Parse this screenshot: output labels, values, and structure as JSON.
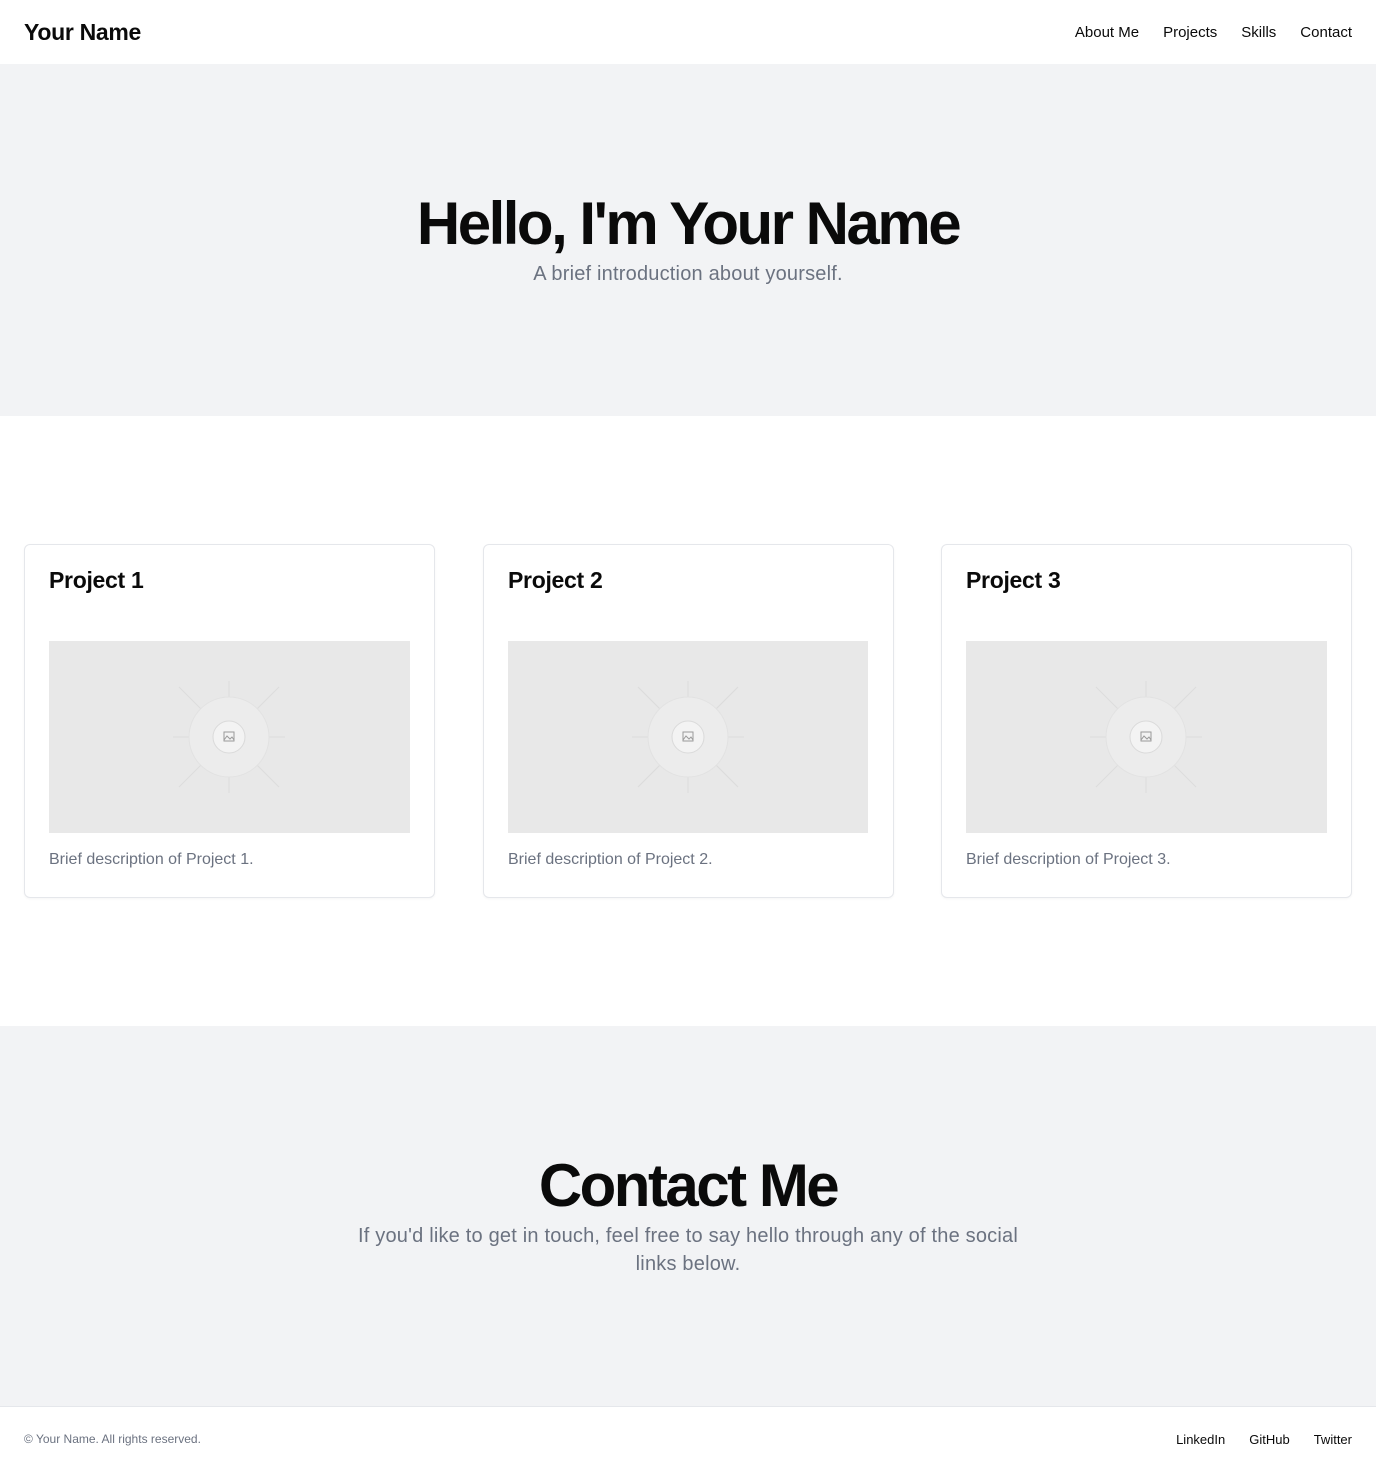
{
  "header": {
    "brand": "Your Name",
    "nav": [
      "About Me",
      "Projects",
      "Skills",
      "Contact"
    ]
  },
  "hero": {
    "title": "Hello, I'm Your Name",
    "subtitle": "A brief introduction about yourself."
  },
  "projects": [
    {
      "title": "Project 1",
      "description": "Brief description of Project 1.",
      "image_icon": "image-placeholder-icon"
    },
    {
      "title": "Project 2",
      "description": "Brief description of Project 2.",
      "image_icon": "image-placeholder-icon"
    },
    {
      "title": "Project 3",
      "description": "Brief description of Project 3.",
      "image_icon": "image-placeholder-icon"
    }
  ],
  "contact": {
    "title": "Contact Me",
    "text": "If you'd like to get in touch, feel free to say hello through any of the social links below."
  },
  "footer": {
    "copyright": "© Your Name. All rights reserved.",
    "social": [
      "LinkedIn",
      "GitHub",
      "Twitter"
    ]
  },
  "colors": {
    "section_bg": "#f2f3f5",
    "muted_text": "#6b7280",
    "border": "#e5e7eb",
    "placeholder_bg": "#e8e8e8"
  }
}
